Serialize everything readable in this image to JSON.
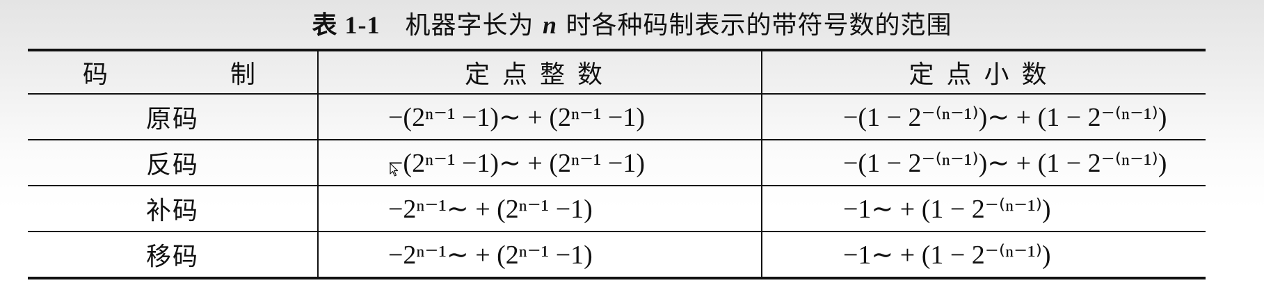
{
  "caption": {
    "number": "表 1-1",
    "text_before": "机器字长为 ",
    "variable": "n",
    "text_after": " 时各种码制表示的带符号数的范围"
  },
  "table": {
    "headers": [
      "码　制",
      "定点整数",
      "定点小数"
    ],
    "rows": [
      {
        "code": "原码",
        "integer_range": "−(2ⁿ⁻¹ −1)∼ + (2ⁿ⁻¹ −1)",
        "fraction_range": "−(1 − 2⁻⁽ⁿ⁻¹⁾)∼ + (1 − 2⁻⁽ⁿ⁻¹⁾)"
      },
      {
        "code": "反码",
        "integer_range": "−(2ⁿ⁻¹ −1)∼ + (2ⁿ⁻¹ −1)",
        "fraction_range": "−(1 − 2⁻⁽ⁿ⁻¹⁾)∼ + (1 − 2⁻⁽ⁿ⁻¹⁾)"
      },
      {
        "code": "补码",
        "integer_range": "−2ⁿ⁻¹∼ + (2ⁿ⁻¹ −1)",
        "fraction_range": "−1∼ + (1 − 2⁻⁽ⁿ⁻¹⁾)"
      },
      {
        "code": "移码",
        "integer_range": "−2ⁿ⁻¹∼ + (2ⁿ⁻¹ −1)",
        "fraction_range": "−1∼ + (1 − 2⁻⁽ⁿ⁻¹⁾)"
      }
    ]
  },
  "icons": {
    "cursor": "mouse-pointer-icon"
  }
}
